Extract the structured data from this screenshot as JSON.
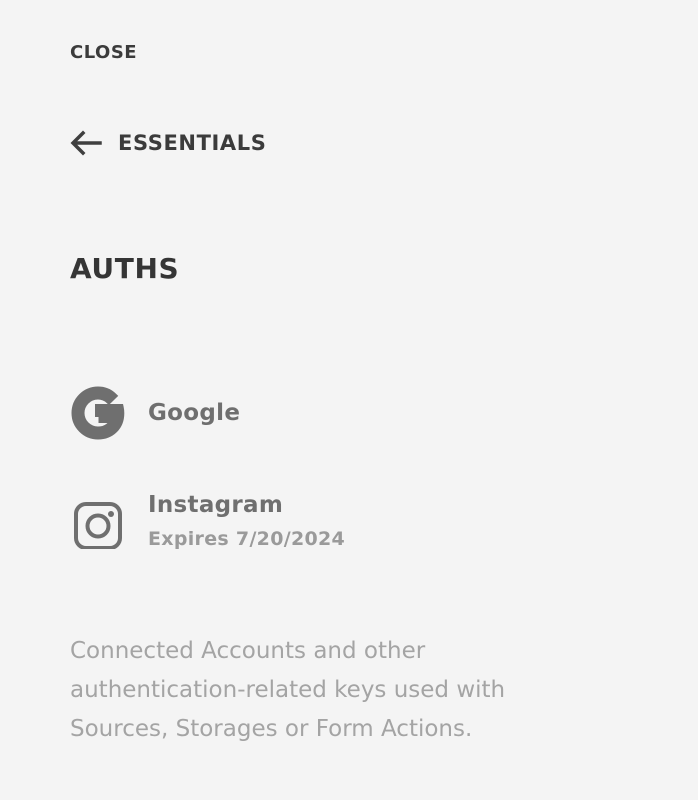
{
  "nav": {
    "close_label": "CLOSE",
    "back_label": "ESSENTIALS"
  },
  "section": {
    "title": "AUTHS"
  },
  "auths": [
    {
      "name": "Google",
      "icon": "google-icon",
      "subtitle": ""
    },
    {
      "name": "Instagram",
      "icon": "instagram-icon",
      "subtitle": "Expires 7/20/2024"
    }
  ],
  "description": "Connected Accounts and other authentication-related keys used with Sources, Storages or Form Actions.",
  "colors": {
    "background": "#f4f4f4",
    "heading": "#353535",
    "icon": "#6f6f6f",
    "muted": "#a4a4a4"
  }
}
